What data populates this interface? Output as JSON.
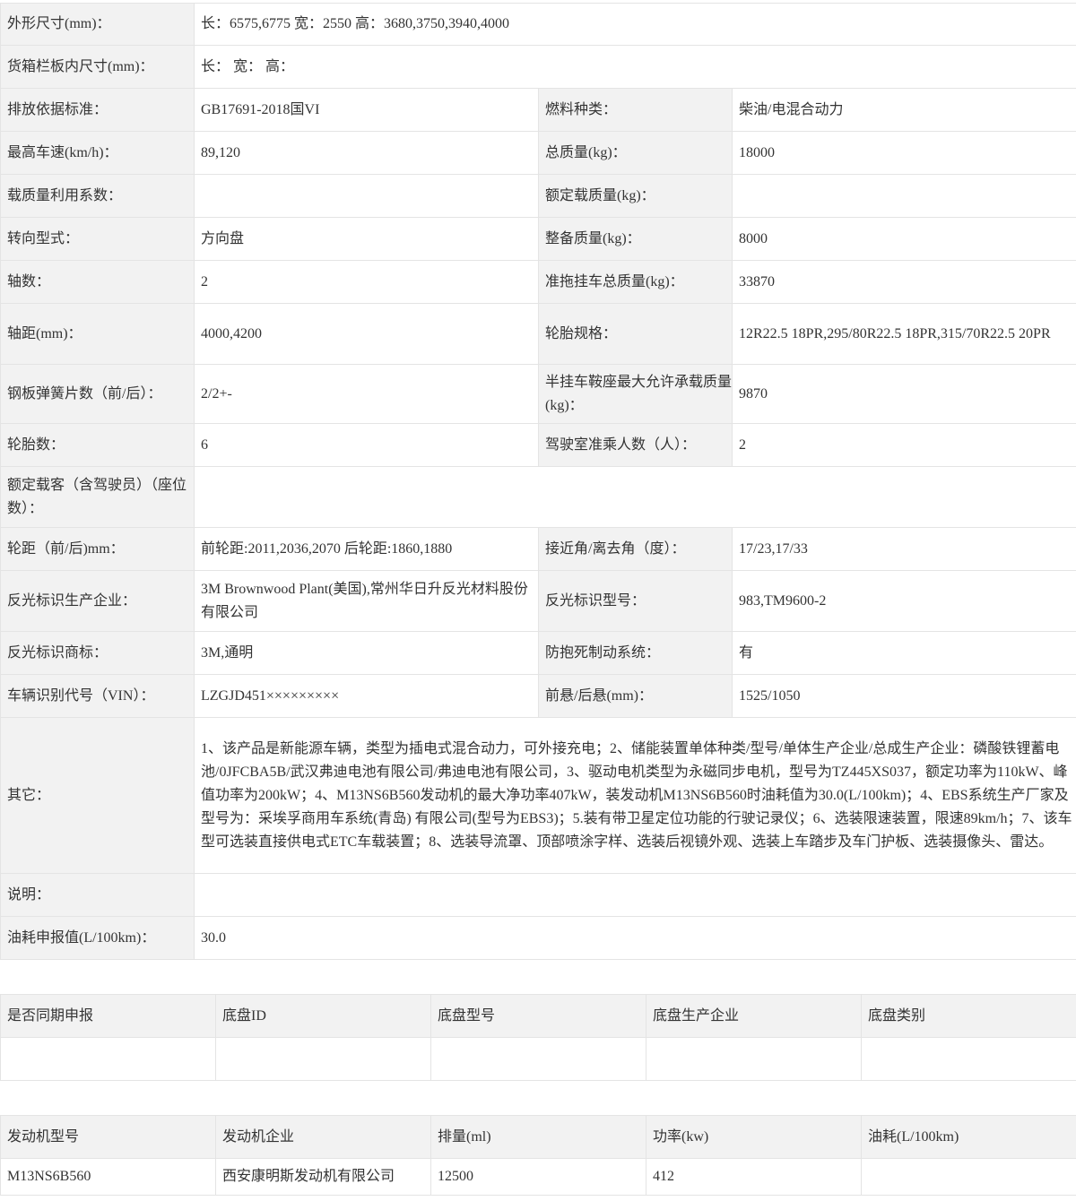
{
  "specs": {
    "dims_label": "外形尺寸(mm)：",
    "dims_value": "长：6575,6775 宽：2550 高：3680,3750,3940,4000",
    "cargo_label": "货箱栏板内尺寸(mm)：",
    "cargo_value": "长： 宽： 高：",
    "emission_label": "排放依据标准：",
    "emission_value": "GB17691-2018国VI",
    "fuel_label": "燃料种类：",
    "fuel_value": "柴油/电混合动力",
    "speed_label": "最高车速(km/h)：",
    "speed_value": "89,120",
    "total_mass_label": "总质量(kg)：",
    "total_mass_value": "18000",
    "load_coef_label": "载质量利用系数：",
    "load_coef_value": "",
    "rated_load_label": "额定载质量(kg)：",
    "rated_load_value": "",
    "steering_label": "转向型式：",
    "steering_value": "方向盘",
    "curb_mass_label": "整备质量(kg)：",
    "curb_mass_value": "8000",
    "axles_label": "轴数：",
    "axles_value": "2",
    "trailer_mass_label": "准拖挂车总质量(kg)：",
    "trailer_mass_value": "33870",
    "wheelbase_label": "轴距(mm)：",
    "wheelbase_value": "4000,4200",
    "tire_spec_label": "轮胎规格：",
    "tire_spec_value": "12R22.5 18PR,295/80R22.5 18PR,315/70R22.5 20PR",
    "leaf_label": "钢板弹簧片数（前/后）：",
    "leaf_value": "2/2+-",
    "saddle_label": "半挂车鞍座最大允许承载质量(kg)：",
    "saddle_value": "9870",
    "tires_label": "轮胎数：",
    "tires_value": "6",
    "cab_label": "驾驶室准乘人数（人）：",
    "cab_value": "2",
    "passengers_label": "额定载客（含驾驶员）（座位数）：",
    "passengers_value": "",
    "track_label": "轮距（前/后)mm：",
    "track_value": "前轮距:2011,2036,2070 后轮距:1860,1880",
    "angle_label": "接近角/离去角（度）：",
    "angle_value": "17/23,17/33",
    "reflect_maker_label": "反光标识生产企业：",
    "reflect_maker_value": "3M Brownwood Plant(美国),常州华日升反光材料股份有限公司",
    "reflect_model_label": "反光标识型号：",
    "reflect_model_value": "983,TM9600-2",
    "reflect_brand_label": "反光标识商标：",
    "reflect_brand_value": "3M,通明",
    "abs_label": "防抱死制动系统：",
    "abs_value": "有",
    "vin_label": "车辆识别代号（VIN）：",
    "vin_value": "LZGJD451×××××××××",
    "overhang_label": "前悬/后悬(mm)：",
    "overhang_value": "1525/1050",
    "other_label": "其它：",
    "other_value": "1、该产品是新能源车辆，类型为插电式混合动力，可外接充电；2、储能装置单体种类/型号/单体生产企业/总成生产企业：磷酸铁锂蓄电池/0JFCBA5B/武汉弗迪电池有限公司/弗迪电池有限公司，3、驱动电机类型为永磁同步电机，型号为TZ445XS037，额定功率为110kW、峰值功率为200kW；4、M13NS6B560发动机的最大净功率407kW，装发动机M13NS6B560时油耗值为30.0(L/100km)；4、EBS系统生产厂家及型号为：采埃孚商用车系统(青岛) 有限公司(型号为EBS3)；5.装有带卫星定位功能的行驶记录仪；6、选装限速装置，限速89km/h；7、该车型可选装直接供电式ETC车载装置；8、选装导流罩、顶部喷涂字样、选装后视镜外观、选装上车踏步及车门护板、选装摄像头、雷达。",
    "note_label": "说明：",
    "note_value": "",
    "fuel_cons_label": "油耗申报值(L/100km)：",
    "fuel_cons_value": "30.0"
  },
  "chassis": {
    "headers": [
      "是否同期申报",
      "底盘ID",
      "底盘型号",
      "底盘生产企业",
      "底盘类别"
    ],
    "row": [
      "",
      "",
      "",
      "",
      ""
    ]
  },
  "engine": {
    "headers": [
      "发动机型号",
      "发动机企业",
      "排量(ml)",
      "功率(kw)",
      "油耗(L/100km)"
    ],
    "row": [
      "M13NS6B560",
      "西安康明斯发动机有限公司",
      "12500",
      "412",
      ""
    ]
  }
}
